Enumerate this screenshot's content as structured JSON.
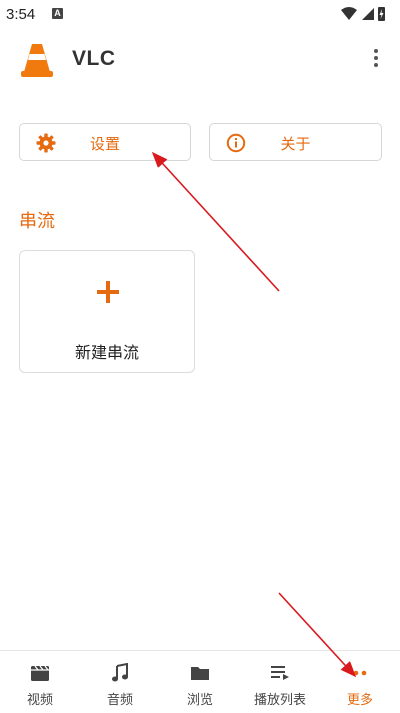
{
  "status_bar": {
    "time": "3:54",
    "notification_badge": "A"
  },
  "app_bar": {
    "title": "VLC"
  },
  "actions": {
    "settings_label": "设置",
    "about_label": "关于"
  },
  "stream_section": {
    "title": "串流",
    "new_stream_label": "新建串流"
  },
  "bottom_nav": {
    "items": [
      {
        "label": "视频",
        "icon": "video-icon"
      },
      {
        "label": "音频",
        "icon": "music-note-icon"
      },
      {
        "label": "浏览",
        "icon": "folder-icon"
      },
      {
        "label": "播放列表",
        "icon": "playlist-icon"
      },
      {
        "label": "更多",
        "icon": "more-dots-icon",
        "active": true
      }
    ]
  },
  "colors": {
    "accent": "#e56a10",
    "annotation_arrow": "#d9191e"
  }
}
